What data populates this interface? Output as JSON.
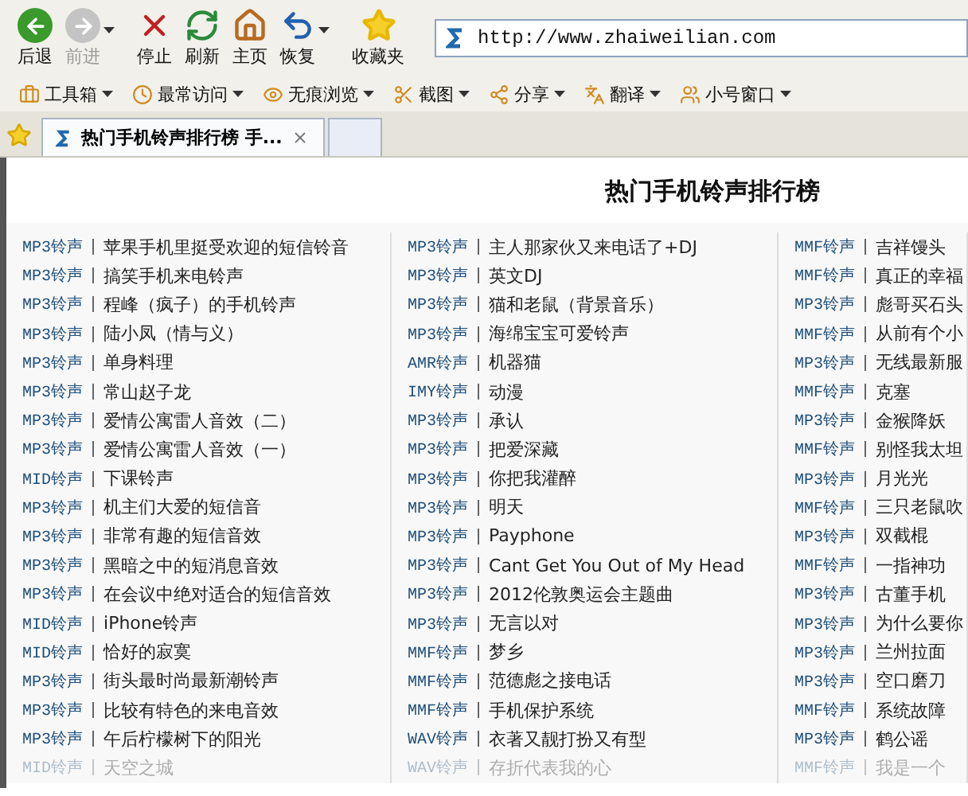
{
  "toolbar": {
    "buttons": [
      {
        "kind": "back",
        "label": "后退",
        "disabled": false,
        "dropdown": false
      },
      {
        "kind": "forward",
        "label": "前进",
        "disabled": true,
        "dropdown": true
      },
      {
        "kind": "stop",
        "label": "停止",
        "disabled": false,
        "dropdown": false
      },
      {
        "kind": "refresh",
        "label": "刷新",
        "disabled": false,
        "dropdown": false
      },
      {
        "kind": "home",
        "label": "主页",
        "disabled": false,
        "dropdown": false
      },
      {
        "kind": "restore",
        "label": "恢复",
        "disabled": false,
        "dropdown": true
      },
      {
        "kind": "favorites",
        "label": "收藏夹",
        "disabled": false,
        "dropdown": false
      }
    ],
    "address": "http://www.zhaiweilian.com"
  },
  "tools": [
    {
      "kind": "toolbox",
      "label": "工具箱"
    },
    {
      "kind": "frequent",
      "label": "最常访问"
    },
    {
      "kind": "private",
      "label": "无痕浏览"
    },
    {
      "kind": "screenshot",
      "label": "截图"
    },
    {
      "kind": "share",
      "label": "分享"
    },
    {
      "kind": "translate",
      "label": "翻译"
    },
    {
      "kind": "window",
      "label": "小号窗口"
    }
  ],
  "tabs": [
    {
      "title": "热门手机铃声排行榜 手...",
      "selected": true
    },
    {
      "selected": false
    }
  ],
  "page": {
    "title": "热门手机铃声排行榜",
    "columns": [
      {
        "rows": [
          {
            "type": "MP3铃声",
            "name": "苹果手机里挺受欢迎的短信铃音",
            "faded": false
          },
          {
            "type": "MP3铃声",
            "name": "搞笑手机来电铃声",
            "faded": false
          },
          {
            "type": "MP3铃声",
            "name": "程峰（疯子）的手机铃声",
            "faded": false
          },
          {
            "type": "MP3铃声",
            "name": "陆小凤（情与义）",
            "faded": false
          },
          {
            "type": "MP3铃声",
            "name": "单身料理",
            "faded": false
          },
          {
            "type": "MP3铃声",
            "name": "常山赵子龙",
            "faded": false
          },
          {
            "type": "MP3铃声",
            "name": "爱情公寓雷人音效（二）",
            "faded": false
          },
          {
            "type": "MP3铃声",
            "name": "爱情公寓雷人音效（一）",
            "faded": false
          },
          {
            "type": "MID铃声",
            "name": "下课铃声",
            "faded": false
          },
          {
            "type": "MP3铃声",
            "name": "机主们大爱的短信音",
            "faded": false
          },
          {
            "type": "MP3铃声",
            "name": "非常有趣的短信音效",
            "faded": false
          },
          {
            "type": "MP3铃声",
            "name": "黑暗之中的短消息音效",
            "faded": false
          },
          {
            "type": "MP3铃声",
            "name": "在会议中绝对适合的短信音效",
            "faded": false
          },
          {
            "type": "MID铃声",
            "name": "iPhone铃声",
            "faded": false
          },
          {
            "type": "MID铃声",
            "name": "恰好的寂寞",
            "faded": false
          },
          {
            "type": "MP3铃声",
            "name": "街头最时尚最新潮铃声",
            "faded": false
          },
          {
            "type": "MP3铃声",
            "name": "比较有特色的来电音效",
            "faded": false
          },
          {
            "type": "MP3铃声",
            "name": "午后柠檬树下的阳光",
            "faded": false
          },
          {
            "type": "MID铃声",
            "name": "天空之城",
            "faded": true
          }
        ]
      },
      {
        "rows": [
          {
            "type": "MP3铃声",
            "name": "主人那家伙又来电话了+DJ",
            "faded": false
          },
          {
            "type": "MP3铃声",
            "name": "英文DJ",
            "faded": false
          },
          {
            "type": "MP3铃声",
            "name": "猫和老鼠（背景音乐）",
            "faded": false
          },
          {
            "type": "MP3铃声",
            "name": "海绵宝宝可爱铃声",
            "faded": false
          },
          {
            "type": "AMR铃声",
            "name": "机器猫",
            "faded": false
          },
          {
            "type": "IMY铃声",
            "name": "动漫",
            "faded": false
          },
          {
            "type": "MP3铃声",
            "name": "承认",
            "faded": false
          },
          {
            "type": "MP3铃声",
            "name": "把爱深藏",
            "faded": false
          },
          {
            "type": "MP3铃声",
            "name": "你把我灌醉",
            "faded": false
          },
          {
            "type": "MP3铃声",
            "name": "明天",
            "faded": false
          },
          {
            "type": "MP3铃声",
            "name": "Payphone",
            "faded": false
          },
          {
            "type": "MP3铃声",
            "name": "Cant Get You Out of My Head",
            "faded": false
          },
          {
            "type": "MP3铃声",
            "name": "2012伦敦奥运会主题曲",
            "faded": false
          },
          {
            "type": "MP3铃声",
            "name": "无言以对",
            "faded": false
          },
          {
            "type": "MMF铃声",
            "name": "梦乡",
            "faded": false
          },
          {
            "type": "MMF铃声",
            "name": "范德彪之接电话",
            "faded": false
          },
          {
            "type": "MMF铃声",
            "name": "手机保护系统",
            "faded": false
          },
          {
            "type": "WAV铃声",
            "name": "衣著又靓打扮又有型",
            "faded": false
          },
          {
            "type": "WAV铃声",
            "name": "存折代表我的心",
            "faded": true
          }
        ]
      },
      {
        "rows": [
          {
            "type": "MMF铃声",
            "name": "吉祥馒头",
            "faded": false
          },
          {
            "type": "MMF铃声",
            "name": "真正的幸福",
            "faded": false
          },
          {
            "type": "MP3铃声",
            "name": "彪哥买石头",
            "faded": false
          },
          {
            "type": "MMF铃声",
            "name": "从前有个小",
            "faded": false
          },
          {
            "type": "MP3铃声",
            "name": "无线最新服",
            "faded": false
          },
          {
            "type": "MMF铃声",
            "name": "克塞",
            "faded": false
          },
          {
            "type": "MP3铃声",
            "name": "金猴降妖",
            "faded": false
          },
          {
            "type": "MMF铃声",
            "name": "别怪我太坦",
            "faded": false
          },
          {
            "type": "MP3铃声",
            "name": "月光光",
            "faded": false
          },
          {
            "type": "MMF铃声",
            "name": "三只老鼠吹",
            "faded": false
          },
          {
            "type": "MP3铃声",
            "name": "双截棍",
            "faded": false
          },
          {
            "type": "MMF铃声",
            "name": "一指神功",
            "faded": false
          },
          {
            "type": "MP3铃声",
            "name": "古董手机",
            "faded": false
          },
          {
            "type": "MP3铃声",
            "name": "为什么要你",
            "faded": false
          },
          {
            "type": "MP3铃声",
            "name": "兰州拉面",
            "faded": false
          },
          {
            "type": "MP3铃声",
            "name": "空口磨刀",
            "faded": false
          },
          {
            "type": "MMF铃声",
            "name": "系统故障",
            "faded": false
          },
          {
            "type": "MP3铃声",
            "name": "鹤公谣",
            "faded": false
          },
          {
            "type": "MMF铃声",
            "name": "我是一个",
            "faded": true
          }
        ]
      }
    ]
  }
}
